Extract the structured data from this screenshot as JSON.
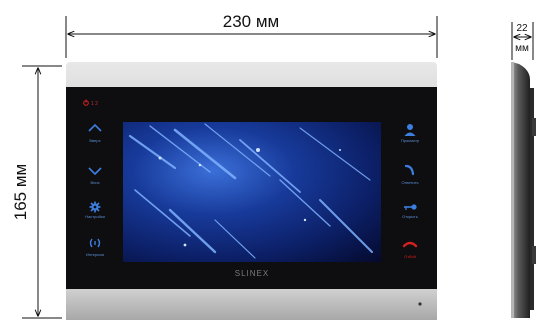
{
  "dimensions": {
    "width": "230 мм",
    "height": "165 мм",
    "depth_value": "22",
    "depth_unit": "мм"
  },
  "device": {
    "brand": "SLINEX",
    "indicators": "1 2",
    "left_buttons": [
      "Вверх",
      "Вниз",
      "Настройки",
      "Интерком"
    ],
    "right_buttons": [
      "Просмотр",
      "Ответить",
      "Открыть",
      "Отбой"
    ]
  },
  "colors": {
    "frame_silver": "#c8c8c8",
    "bezel_black": "#0e0e10",
    "icon_blue": "#3d7fe0",
    "hangup_red": "#d8201e"
  },
  "icons": {
    "left": [
      "chevron-up-icon",
      "chevron-down-icon",
      "gear-icon",
      "intercom-icon"
    ],
    "right": [
      "person-icon",
      "phone-answer-icon",
      "key-icon",
      "phone-hangup-icon"
    ]
  }
}
